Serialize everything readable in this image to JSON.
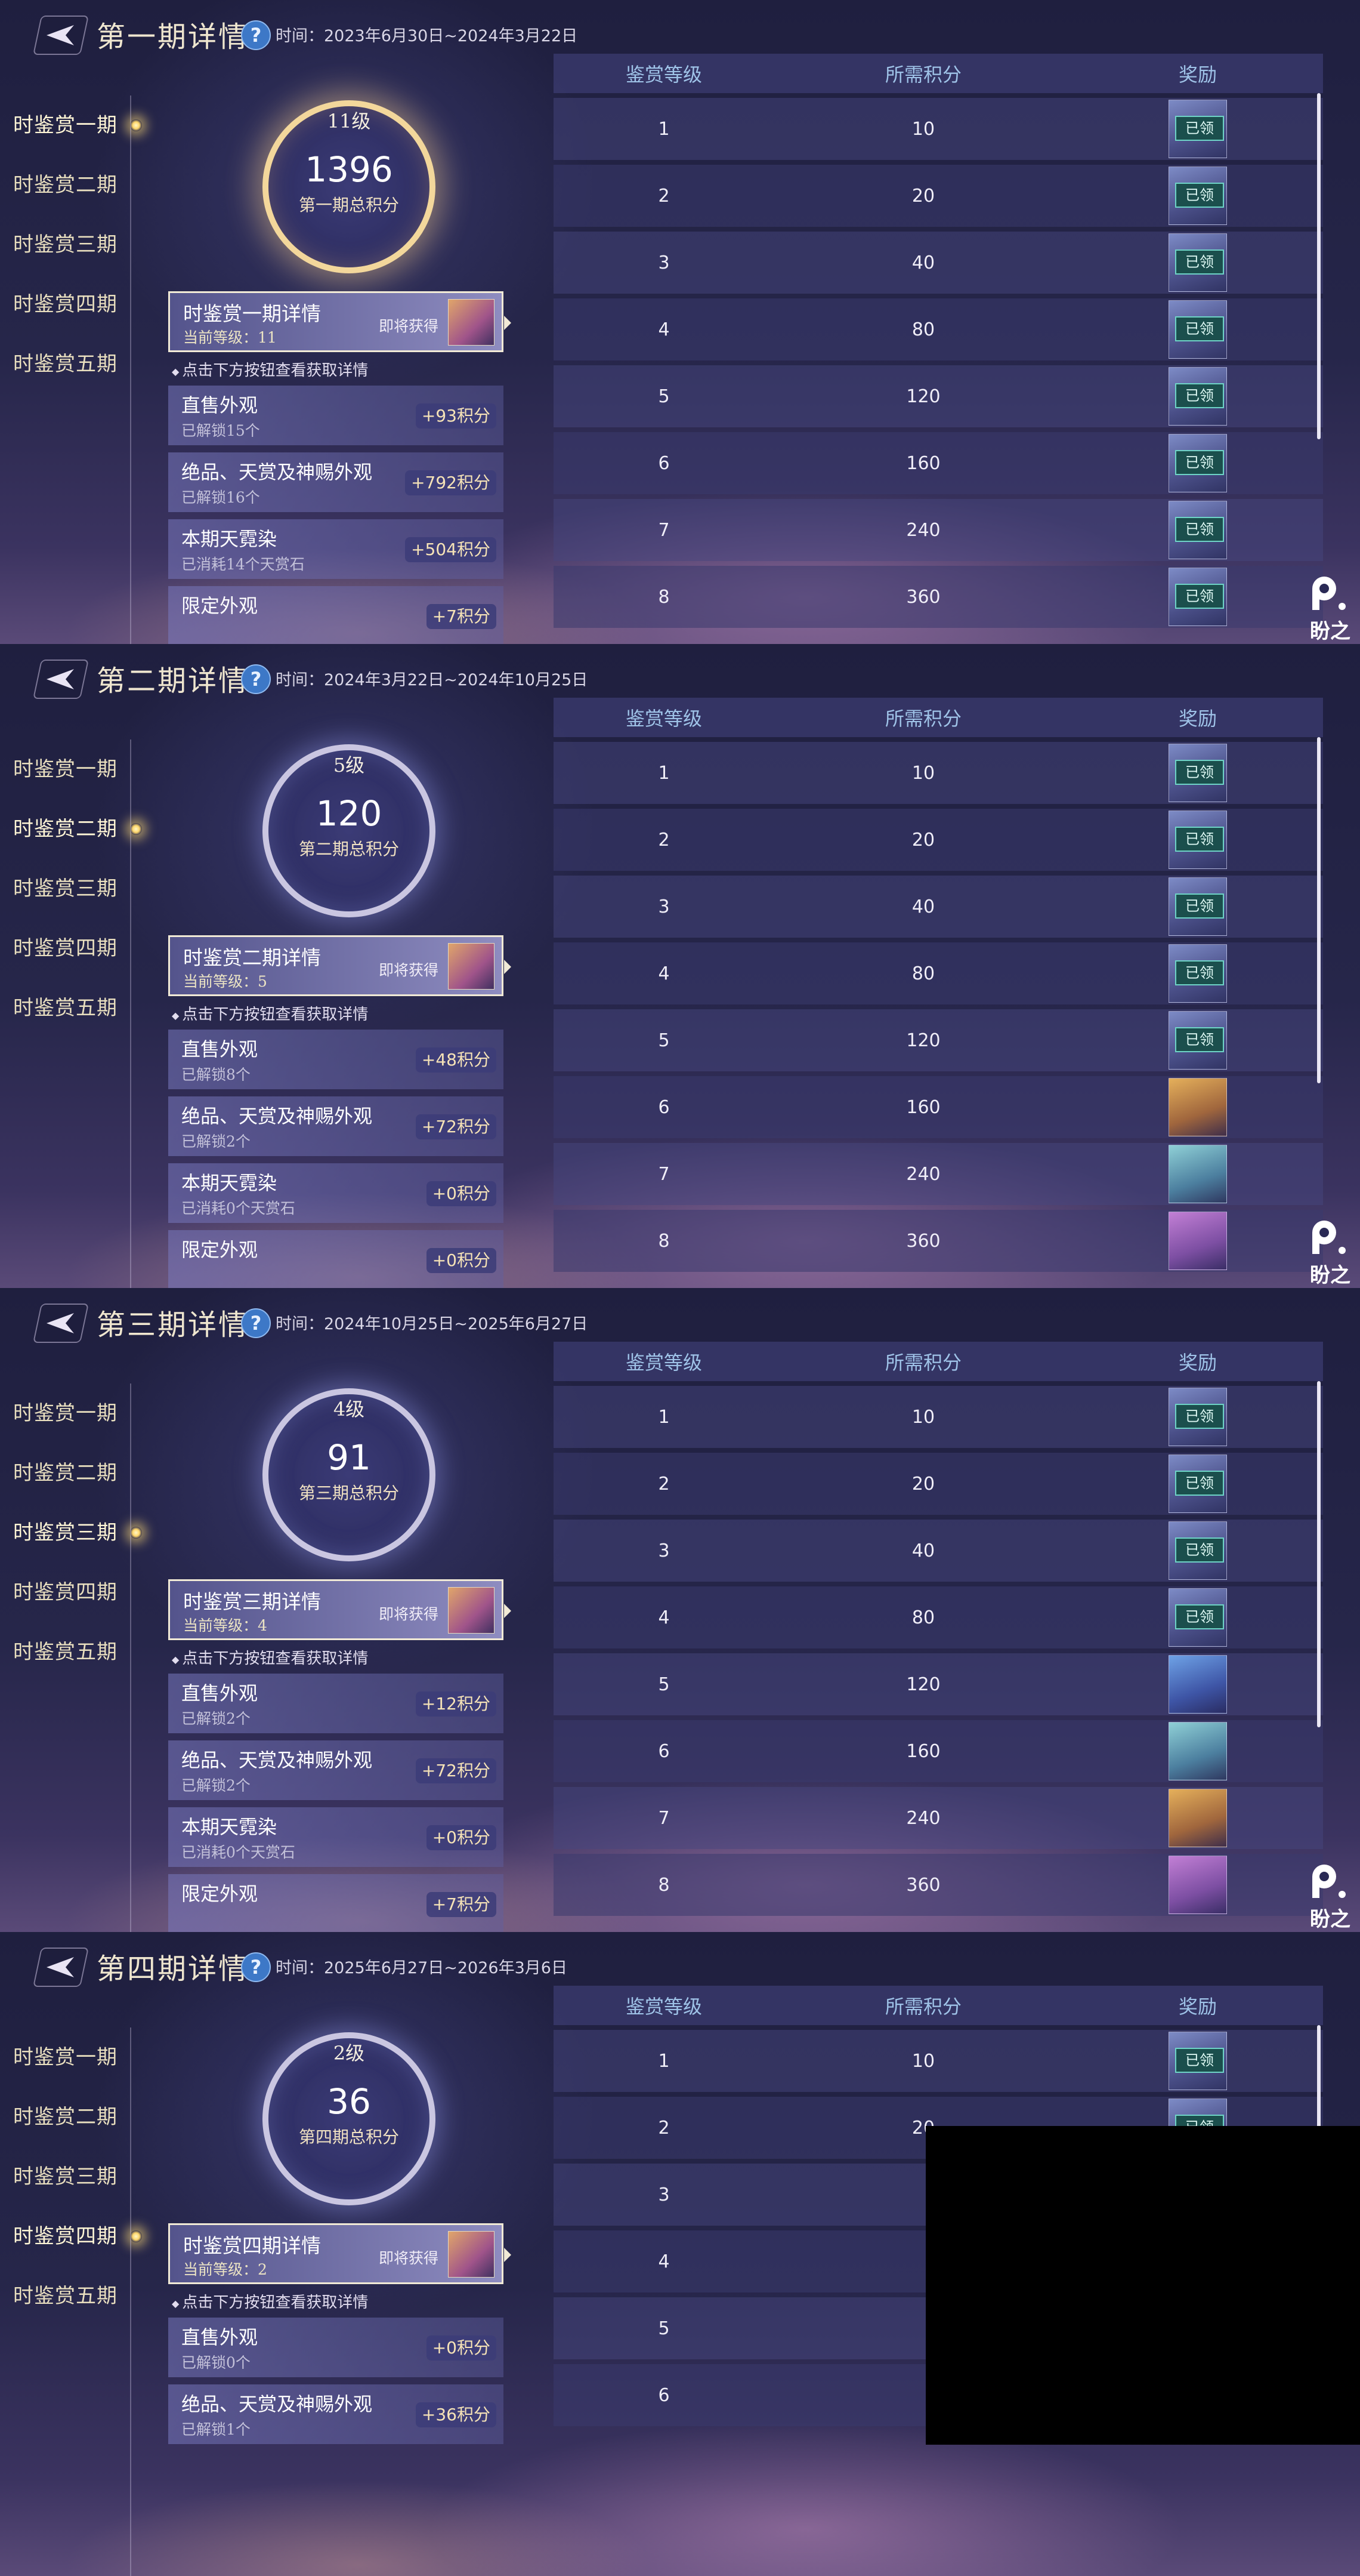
{
  "panels": [
    {
      "title": "第一期详情",
      "time": "时间：2023年6月30日~2024年3月22日",
      "active_index": 0,
      "level": "11级",
      "score": "1396",
      "score_caption": "第一期总积分",
      "detail": {
        "title": "时鉴赏一期详情",
        "level": "当前等级：11",
        "soon": "即将获得"
      },
      "sources": [
        {
          "title": "直售外观",
          "sub": "已解锁15个",
          "badge": "+93积分"
        },
        {
          "title": "绝品、天赏及神赐外观",
          "sub": "已解锁16个",
          "badge": "+792积分"
        },
        {
          "title": "本期天霓染",
          "sub": "已消耗14个天赏石",
          "badge": "+504积分"
        },
        {
          "title": "限定外观",
          "sub": "",
          "badge": "+7积分"
        }
      ],
      "rewards": [
        "claimed",
        "claimed",
        "claimed",
        "claimed",
        "claimed",
        "claimed",
        "claimed",
        "claimed"
      ]
    },
    {
      "title": "第二期详情",
      "time": "时间：2024年3月22日~2024年10月25日",
      "active_index": 1,
      "level": "5级",
      "score": "120",
      "score_caption": "第二期总积分",
      "detail": {
        "title": "时鉴赏二期详情",
        "level": "当前等级：5",
        "soon": "即将获得"
      },
      "sources": [
        {
          "title": "直售外观",
          "sub": "已解锁8个",
          "badge": "+48积分"
        },
        {
          "title": "绝品、天赏及神赐外观",
          "sub": "已解锁2个",
          "badge": "+72积分"
        },
        {
          "title": "本期天霓染",
          "sub": "已消耗0个天赏石",
          "badge": "+0积分"
        },
        {
          "title": "限定外观",
          "sub": "",
          "badge": "+0积分"
        }
      ],
      "rewards": [
        "claimed",
        "claimed",
        "claimed",
        "claimed",
        "claimed",
        "gold",
        "teal",
        "pink"
      ]
    },
    {
      "title": "第三期详情",
      "time": "时间：2024年10月25日~2025年6月27日",
      "active_index": 2,
      "level": "4级",
      "score": "91",
      "score_caption": "第三期总积分",
      "detail": {
        "title": "时鉴赏三期详情",
        "level": "当前等级：4",
        "soon": "即将获得"
      },
      "sources": [
        {
          "title": "直售外观",
          "sub": "已解锁2个",
          "badge": "+12积分"
        },
        {
          "title": "绝品、天赏及神赐外观",
          "sub": "已解锁2个",
          "badge": "+72积分"
        },
        {
          "title": "本期天霓染",
          "sub": "已消耗0个天赏石",
          "badge": "+0积分"
        },
        {
          "title": "限定外观",
          "sub": "",
          "badge": "+7积分"
        }
      ],
      "rewards": [
        "claimed",
        "claimed",
        "claimed",
        "claimed",
        "blue",
        "teal",
        "gold",
        "pink"
      ]
    },
    {
      "title": "第四期详情",
      "time": "时间：2025年6月27日~2026年3月6日",
      "active_index": 3,
      "level": "2级",
      "score": "36",
      "score_caption": "第四期总积分",
      "detail": {
        "title": "时鉴赏四期详情",
        "level": "当前等级：2",
        "soon": "即将获得"
      },
      "sources": [
        {
          "title": "直售外观",
          "sub": "已解锁0个",
          "badge": "+0积分"
        },
        {
          "title": "绝品、天赏及神赐外观",
          "sub": "已解锁1个",
          "badge": "+36积分"
        }
      ],
      "rewards": [
        "claimed",
        "claimed",
        "",
        "",
        "",
        ""
      ]
    }
  ],
  "sidebar_items": [
    "时鉴赏一期",
    "时鉴赏二期",
    "时鉴赏三期",
    "时鉴赏四期",
    "时鉴赏五期"
  ],
  "hint": "点击下方按钮查看获取详情",
  "table_headers": [
    "鉴赏等级",
    "所需积分",
    "奖励"
  ],
  "table_rows": [
    {
      "level": "1",
      "points": "10"
    },
    {
      "level": "2",
      "points": "20"
    },
    {
      "level": "3",
      "points": "40"
    },
    {
      "level": "4",
      "points": "80"
    },
    {
      "level": "5",
      "points": "120"
    },
    {
      "level": "6",
      "points": "160"
    },
    {
      "level": "7",
      "points": "240"
    },
    {
      "level": "8",
      "points": "360"
    }
  ],
  "claimed_label": "已领",
  "panel4_points_visible": [
    "10",
    "20"
  ],
  "watermark": "盼之",
  "icons": {
    "back": "back-arrow-icon",
    "help": "help-icon"
  },
  "colors": {
    "title": "#efe6cf",
    "header": "#9fc3e8",
    "badge": "#f6e3b7",
    "claimed_bg": "#1b4f4d"
  }
}
